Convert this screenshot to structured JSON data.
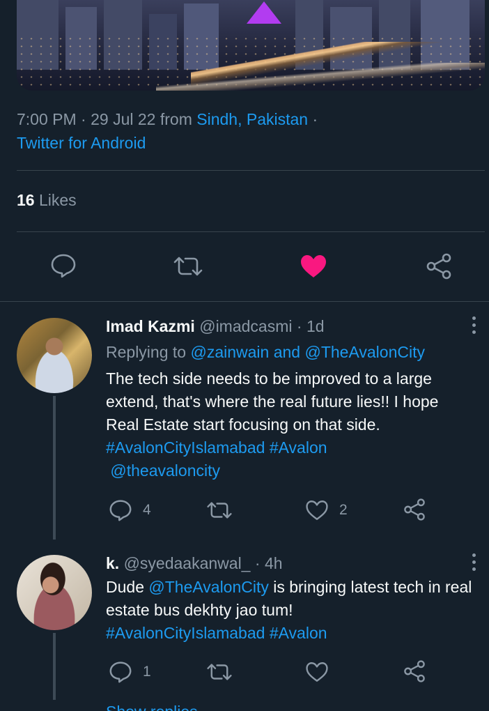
{
  "tweet": {
    "time": "7:00 PM",
    "date": "29 Jul 22",
    "from_label": "from",
    "location": "Sindh, Pakistan",
    "source": "Twitter for Android",
    "likes_count": "16",
    "likes_label": "Likes"
  },
  "actions": {
    "icons": [
      "reply-icon",
      "retweet-icon",
      "like-icon-filled",
      "share-icon"
    ],
    "like_color": "#f91880",
    "accent": "#1d9bf0"
  },
  "replies": [
    {
      "name": "Imad Kazmi",
      "handle": "@imadcasmi",
      "time": "1d",
      "replying_to_label": "Replying to",
      "replying_to_1": "@zainwain",
      "and_label": "and",
      "replying_to_2": "@TheAvalonCity",
      "text_1": "The tech side needs to be improved to a large extend, that's where the real future lies!! I hope Real Estate start focusing on that side.",
      "hashtag_1": "#AvalonCityIslamabad",
      "hashtag_2": "#Avalon",
      "mention": "@theavaloncity",
      "reply_count": "4",
      "like_count": "2"
    },
    {
      "name": "k.",
      "handle": "@syedaakanwal_",
      "time": "4h",
      "text_pre": "Dude",
      "mention": "@TheAvalonCity",
      "text_post": "is bringing latest tech in real estate bus dekhty jao tum!",
      "hashtag_1": "#AvalonCityIslamabad",
      "hashtag_2": "#Avalon",
      "reply_count": "1"
    }
  ],
  "show_replies": "Show replies"
}
